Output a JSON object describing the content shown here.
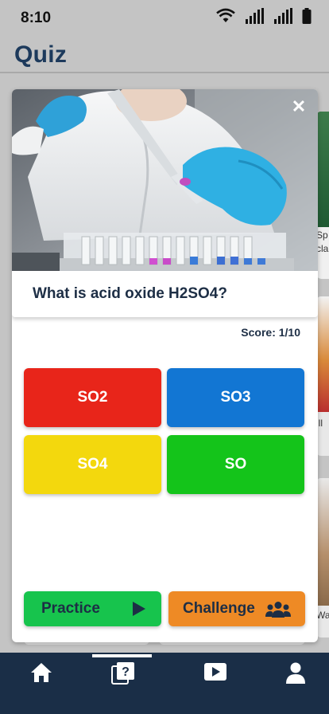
{
  "status_bar": {
    "time": "8:10"
  },
  "header": {
    "title": "Quiz"
  },
  "quiz": {
    "question": "What is acid oxide H2SO4?",
    "score": "Score: 1/10",
    "answers": [
      {
        "label": "SO2",
        "color": "#e8251a"
      },
      {
        "label": "SO3",
        "color": "#1276d3"
      },
      {
        "label": "SO4",
        "color": "#f3d80d"
      },
      {
        "label": "SO",
        "color": "#14c41a"
      }
    ],
    "practice_label": "Practice",
    "challenge_label": "Challenge",
    "practice_color": "#17c44d",
    "challenge_color": "#ee8a25"
  },
  "background_cards": {
    "label_1": "Sp",
    "label_2": "cla",
    "label_3": "ill",
    "label_4": "Wa"
  },
  "bottom_nav": {
    "items": [
      "home-icon",
      "quiz-icon",
      "video-icon",
      "profile-icon"
    ],
    "active": "quiz-icon"
  }
}
